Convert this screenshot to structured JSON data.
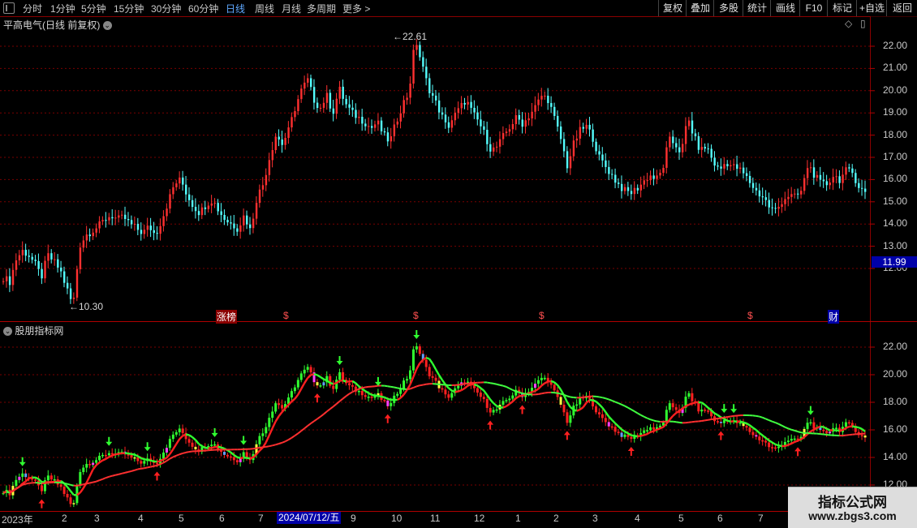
{
  "toolbar": {
    "periods": [
      "分时",
      "1分钟",
      "5分钟",
      "15分钟",
      "30分钟",
      "60分钟",
      "日线",
      "周线",
      "月线",
      "多周期",
      "更多 >"
    ],
    "active_period": "日线",
    "right_buttons": [
      "复权",
      "叠加",
      "多股",
      "统计",
      "画线",
      "F10",
      "标记",
      "+自选",
      "返回"
    ]
  },
  "main_panel": {
    "title": "平高电气(日线 前复权)",
    "y_ticks": [
      "22.00",
      "21.00",
      "20.00",
      "19.00",
      "18.00",
      "17.00",
      "16.00",
      "15.00",
      "14.00",
      "13.00",
      "12.00"
    ],
    "high_label": "22.61",
    "low_label": "10.30",
    "current_price": "11.99",
    "event_markers": [
      "涨榜",
      "$",
      "$",
      "$",
      "$",
      "财"
    ]
  },
  "indicator_panel": {
    "title": "股朋指标网",
    "y_ticks": [
      "22.00",
      "20.00",
      "18.00",
      "16.00",
      "14.00",
      "12.00"
    ]
  },
  "x_axis": {
    "labels": [
      "2023年",
      "2",
      "3",
      "4",
      "5",
      "6",
      "7",
      "9",
      "10",
      "11",
      "12",
      "1",
      "2",
      "3",
      "4",
      "5",
      "6",
      "7"
    ],
    "cursor_date": "2024/07/12/五"
  },
  "watermark": {
    "line1": "指标公式网",
    "line2": "www.zbgs3.com"
  },
  "colors": {
    "up": "#ff3030",
    "down": "#54ffff",
    "ma_up": "#ff2020",
    "ma_down": "#30ff30",
    "grid": "#8b0000",
    "arrow_up": "#ff2020",
    "arrow_down": "#30ff30",
    "accent": "#0000a8"
  },
  "chart_data": {
    "type": "candlestick",
    "series": [
      {
        "values": [
          [
            2023.0,
            11.6
          ],
          [
            2023.04,
            11.4
          ],
          [
            2023.08,
            12.4
          ],
          [
            2023.12,
            12.8
          ],
          [
            2023.16,
            12.6
          ],
          [
            2023.2,
            12.2
          ],
          [
            2023.24,
            11.6
          ],
          [
            2023.28,
            12.6
          ],
          [
            2023.32,
            12.3
          ],
          [
            2023.36,
            11.9
          ],
          [
            2023.4,
            11.1
          ],
          [
            2023.44,
            10.3
          ],
          [
            2023.48,
            13.0
          ],
          [
            2023.52,
            13.5
          ],
          [
            2023.56,
            13.7
          ],
          [
            2023.6,
            13.9
          ],
          [
            2023.64,
            14.2
          ],
          [
            2023.68,
            14.4
          ],
          [
            2023.72,
            14.2
          ],
          [
            2023.76,
            14.3
          ],
          [
            2023.8,
            14.0
          ],
          [
            2023.84,
            13.8
          ],
          [
            2023.88,
            13.6
          ],
          [
            2023.92,
            13.9
          ],
          [
            2023.96,
            13.5
          ],
          [
            2024.0,
            14.2
          ],
          [
            2024.04,
            15.0
          ],
          [
            2024.08,
            15.8
          ],
          [
            2024.12,
            16.0
          ],
          [
            2024.16,
            15.3
          ],
          [
            2024.2,
            14.8
          ],
          [
            2024.24,
            14.5
          ],
          [
            2024.28,
            14.9
          ],
          [
            2024.32,
            15.1
          ],
          [
            2024.36,
            14.6
          ],
          [
            2024.4,
            14.2
          ],
          [
            2024.44,
            14.0
          ],
          [
            2024.48,
            13.8
          ],
          [
            2024.52,
            14.4
          ],
          [
            2024.56,
            13.7
          ],
          [
            2024.6,
            15.2
          ],
          [
            2024.64,
            15.8
          ],
          [
            2024.68,
            17.0
          ],
          [
            2024.72,
            18.0
          ],
          [
            2024.76,
            17.6
          ],
          [
            2024.8,
            18.2
          ],
          [
            2024.84,
            19.2
          ],
          [
            2024.88,
            20.0
          ],
          [
            2024.92,
            20.5
          ],
          [
            2024.96,
            19.6
          ],
          [
            2025.0,
            19.2
          ],
          [
            2025.04,
            19.8
          ],
          [
            2025.08,
            19.0
          ],
          [
            2025.12,
            20.1
          ],
          [
            2025.16,
            19.4
          ],
          [
            2025.2,
            19.0
          ],
          [
            2025.24,
            18.8
          ],
          [
            2025.28,
            18.6
          ],
          [
            2025.32,
            18.3
          ],
          [
            2025.36,
            18.6
          ],
          [
            2025.4,
            18.0
          ],
          [
            2025.44,
            17.7
          ],
          [
            2025.48,
            18.6
          ],
          [
            2025.52,
            19.4
          ],
          [
            2025.56,
            19.9
          ],
          [
            2025.6,
            22.4
          ],
          [
            2025.64,
            21.2
          ],
          [
            2025.68,
            20.2
          ],
          [
            2025.72,
            19.6
          ],
          [
            2025.76,
            19.0
          ],
          [
            2025.8,
            18.3
          ],
          [
            2025.84,
            18.8
          ],
          [
            2025.88,
            19.2
          ],
          [
            2025.92,
            19.6
          ],
          [
            2025.96,
            19.0
          ],
          [
            2026.0,
            18.6
          ],
          [
            2026.04,
            18.0
          ],
          [
            2026.08,
            17.3
          ],
          [
            2026.12,
            17.5
          ],
          [
            2026.16,
            18.0
          ],
          [
            2026.2,
            18.4
          ],
          [
            2026.24,
            18.8
          ],
          [
            2026.28,
            18.5
          ],
          [
            2026.32,
            18.9
          ],
          [
            2026.36,
            19.3
          ],
          [
            2026.4,
            19.8
          ],
          [
            2026.44,
            19.6
          ],
          [
            2026.48,
            18.7
          ],
          [
            2026.52,
            17.8
          ],
          [
            2026.56,
            16.6
          ],
          [
            2026.6,
            17.6
          ],
          [
            2026.64,
            18.2
          ],
          [
            2026.68,
            18.4
          ],
          [
            2026.72,
            17.9
          ],
          [
            2026.76,
            17.0
          ],
          [
            2026.8,
            16.6
          ],
          [
            2026.84,
            16.2
          ],
          [
            2026.88,
            15.8
          ],
          [
            2026.92,
            15.5
          ],
          [
            2026.96,
            15.4
          ],
          [
            2027.0,
            15.6
          ],
          [
            2027.04,
            15.9
          ],
          [
            2027.08,
            16.2
          ],
          [
            2027.12,
            16.0
          ],
          [
            2027.16,
            16.4
          ],
          [
            2027.2,
            17.8
          ],
          [
            2027.24,
            17.6
          ],
          [
            2027.28,
            17.2
          ],
          [
            2027.32,
            18.8
          ],
          [
            2027.36,
            17.9
          ],
          [
            2027.4,
            17.3
          ],
          [
            2027.44,
            17.5
          ],
          [
            2027.48,
            16.8
          ],
          [
            2027.52,
            16.4
          ],
          [
            2027.56,
            16.8
          ],
          [
            2027.6,
            16.6
          ],
          [
            2027.64,
            16.5
          ],
          [
            2027.68,
            16.2
          ],
          [
            2027.72,
            15.8
          ],
          [
            2027.76,
            15.4
          ],
          [
            2027.8,
            15.2
          ],
          [
            2027.84,
            14.7
          ],
          [
            2027.88,
            14.6
          ],
          [
            2027.92,
            15.1
          ],
          [
            2027.96,
            15.3
          ],
          [
            2028.0,
            15.2
          ],
          [
            2028.04,
            15.5
          ],
          [
            2028.08,
            16.7
          ],
          [
            2028.12,
            16.2
          ],
          [
            2028.16,
            15.8
          ],
          [
            2028.2,
            15.8
          ],
          [
            2028.24,
            16.2
          ],
          [
            2028.28,
            16.0
          ],
          [
            2028.32,
            16.4
          ],
          [
            2028.36,
            16.3
          ],
          [
            2028.4,
            15.7
          ],
          [
            2028.44,
            15.4
          ]
        ]
      }
    ],
    "ylim_main": [
      11.2,
      22.9
    ],
    "ylim_indicator": [
      11.8,
      23.0
    ]
  }
}
